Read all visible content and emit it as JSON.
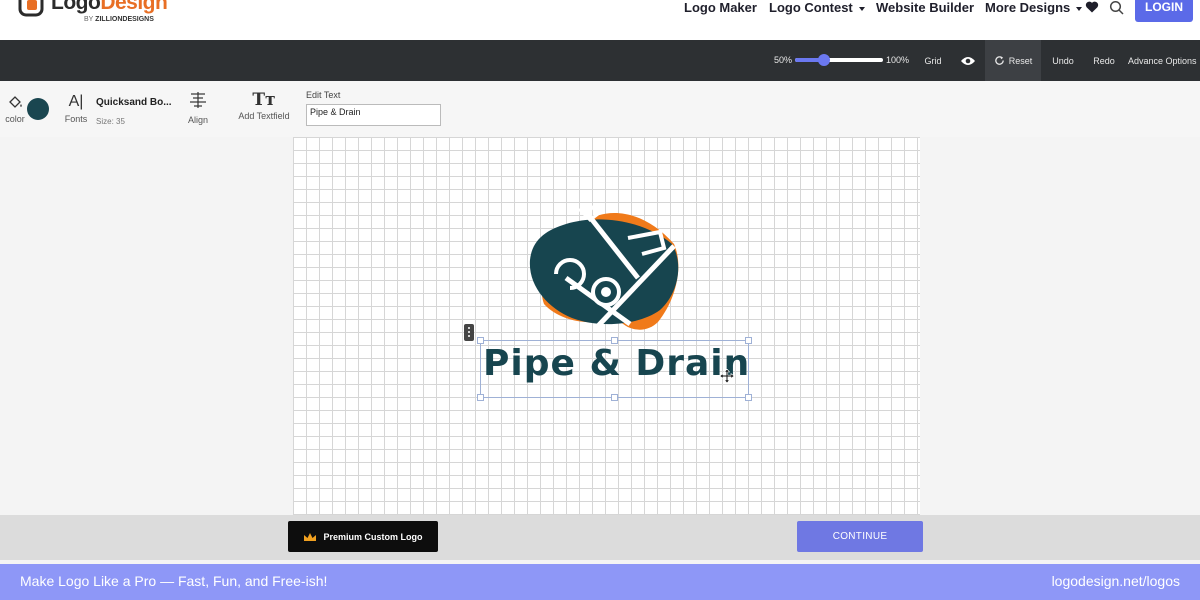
{
  "brand": {
    "name_dark": "Logo",
    "name_accent": "Design",
    "by_prefix": "BY",
    "by_company": "ZILLIONDESIGNS",
    "accent_color": "#e86f25"
  },
  "nav": {
    "links": [
      {
        "label": "Logo Maker",
        "dropdown": false
      },
      {
        "label": "Logo Contest",
        "dropdown": true
      },
      {
        "label": "Website Builder",
        "dropdown": false
      },
      {
        "label": "More Designs",
        "dropdown": true
      }
    ],
    "icons": [
      "heart-icon",
      "search-icon"
    ],
    "login_label": "LOGIN",
    "login_color": "#5b6ae8"
  },
  "toolbar": {
    "zoom_min": "50%",
    "zoom_max": "100%",
    "zoom_level": 0.3,
    "grid_label": "Grid",
    "reset_label": "Reset",
    "undo_label": "Undo",
    "redo_label": "Redo",
    "advance_label": "Advance Options"
  },
  "tools": {
    "color_label": "color",
    "color_value": "#1a4650",
    "fonts_label": "Fonts",
    "font_name": "Quicksand Bo...",
    "font_size": "Size: 35",
    "align_label": "Align",
    "add_textfield_label": "Add Textfield",
    "edit_text_label": "Edit Text",
    "edit_text_value": "Pipe & Drain"
  },
  "canvas": {
    "logo_text": "Pipe & Drain",
    "logo_text_color": "#17454f",
    "blob_dark_color": "#17454f",
    "blob_orange_color": "#f07a1a"
  },
  "bottom": {
    "premium_label": "Premium Custom Logo",
    "continue_label": "CONTINUE"
  },
  "footer": {
    "left_text": "Make Logo Like a Pro — Fast, Fun, and Free-ish!",
    "right_text": "logodesign.net/logos",
    "bg_color": "#8e97f7"
  }
}
